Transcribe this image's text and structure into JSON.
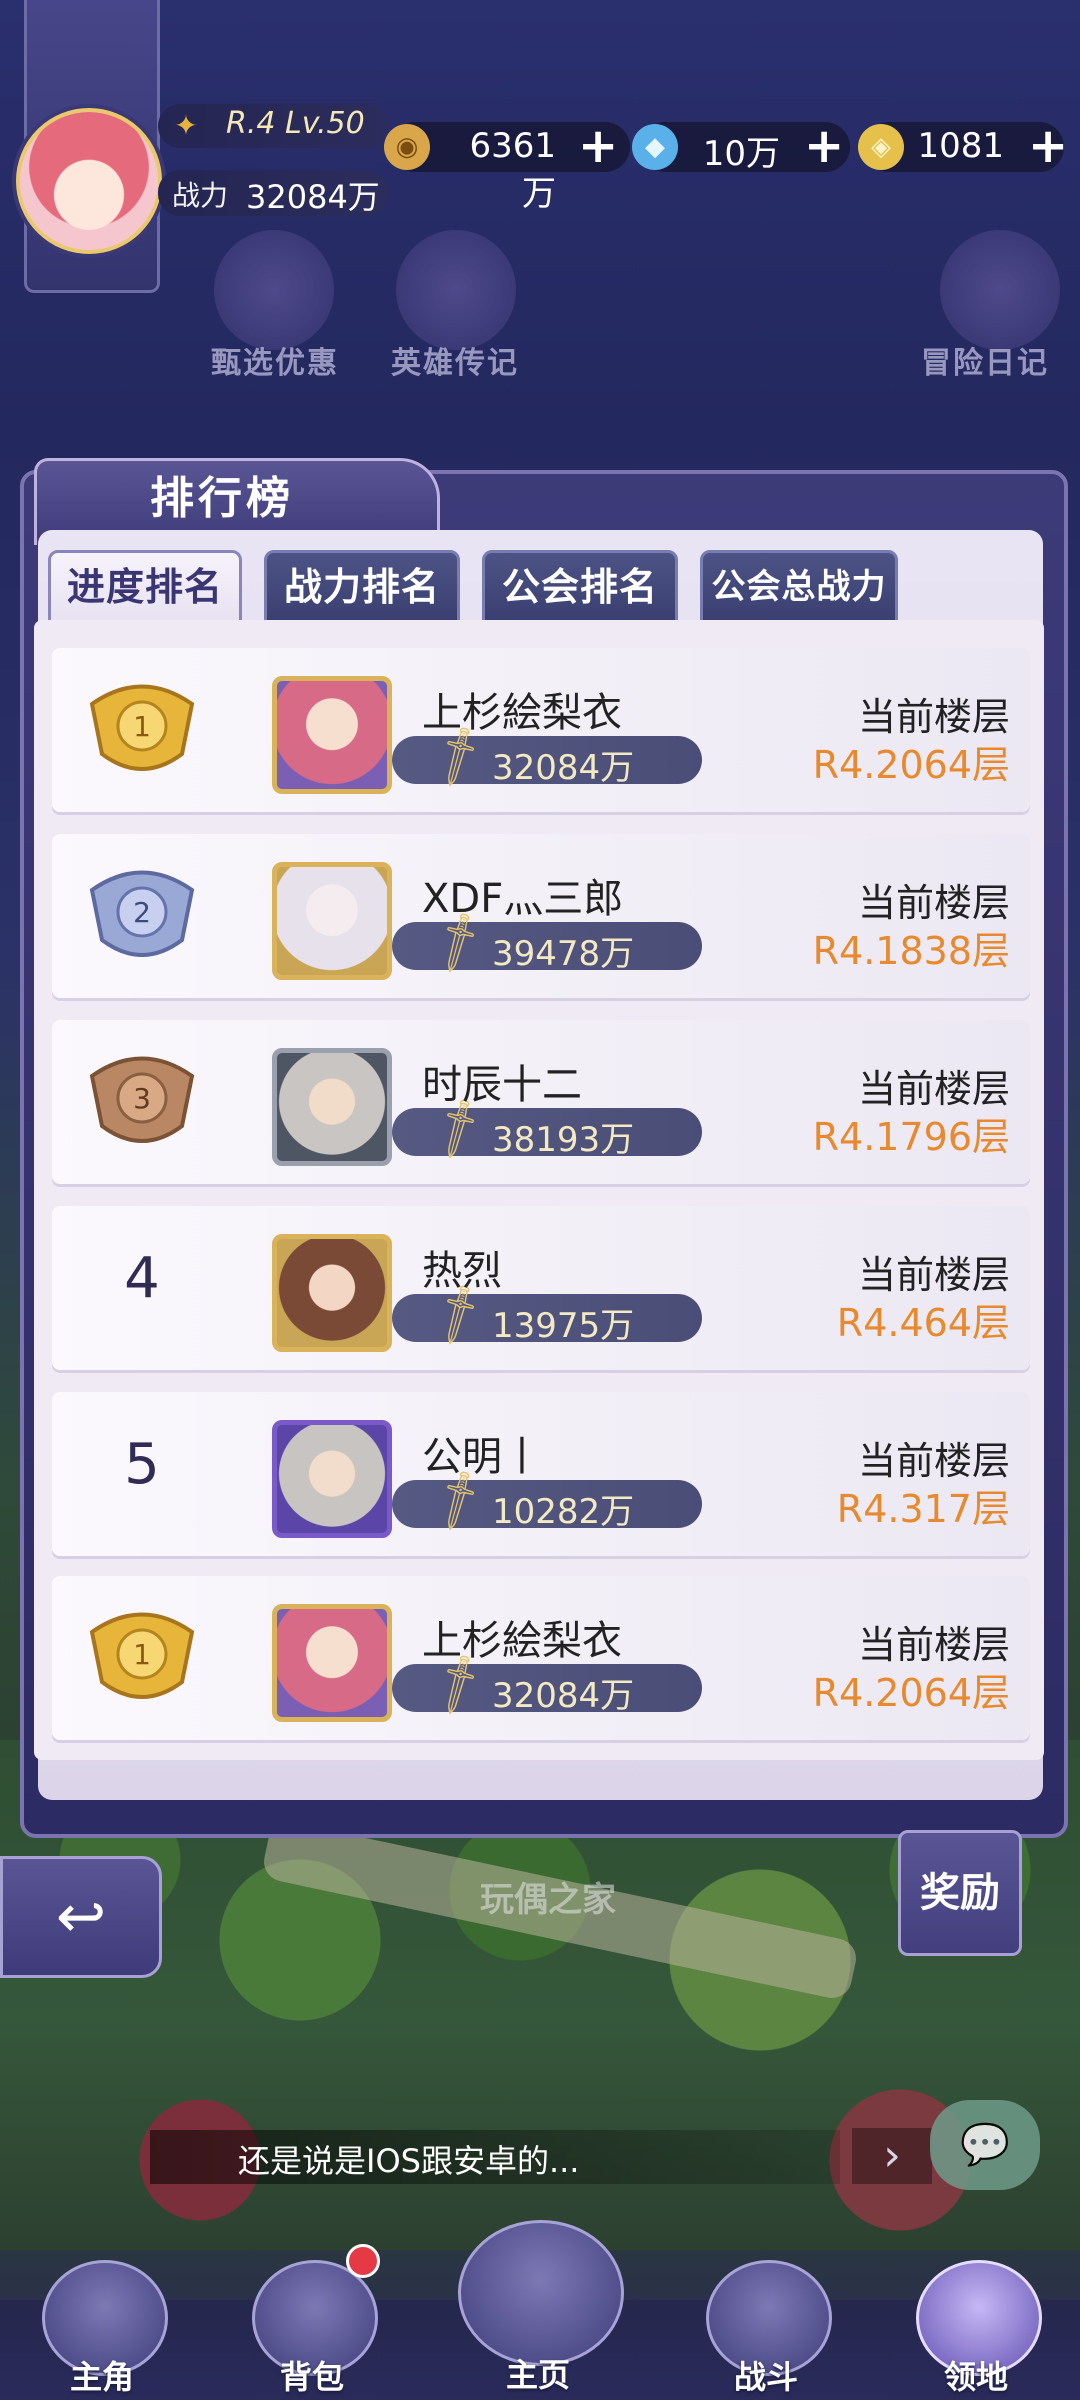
{
  "profile": {
    "level": "R.4 Lv.50",
    "power_label": "战力",
    "power_value": "32084万"
  },
  "resources": [
    {
      "icon": "gold-coin-icon",
      "value": "6361万"
    },
    {
      "icon": "diamond-icon",
      "value": "10万"
    },
    {
      "icon": "gem-icon",
      "value": "1081"
    }
  ],
  "shortcuts": [
    "甄选优惠",
    "英雄传记",
    "冒险日记"
  ],
  "panel": {
    "title": "排行榜",
    "tabs": [
      "进度排名",
      "战力排名",
      "公会排名",
      "公会总战力"
    ],
    "active_tab_index": 0
  },
  "rankings": [
    {
      "rank": "1",
      "name": "上杉絵梨衣",
      "power": "32084万",
      "floor_label": "当前楼层",
      "floor": "R4.2064层"
    },
    {
      "rank": "2",
      "name": "XDF灬三郎",
      "power": "39478万",
      "floor_label": "当前楼层",
      "floor": "R4.1838层"
    },
    {
      "rank": "3",
      "name": "时辰十二",
      "power": "38193万",
      "floor_label": "当前楼层",
      "floor": "R4.1796层"
    },
    {
      "rank": "4",
      "name": "热烈",
      "power": "13975万",
      "floor_label": "当前楼层",
      "floor": "R4.464层"
    },
    {
      "rank": "5",
      "name": "公明丨",
      "power": "10282万",
      "floor_label": "当前楼层",
      "floor": "R4.317层"
    }
  ],
  "my_rank": {
    "rank": "1",
    "name": "上杉絵梨衣",
    "power": "32084万",
    "floor_label": "当前楼层",
    "floor": "R4.2064层"
  },
  "reward_button": "奖励",
  "place_label": "玩偶之家",
  "chat": {
    "message": "还是说是IOS跟安卓的..."
  },
  "nav": [
    "主角",
    "背包",
    "主页",
    "战斗",
    "领地"
  ],
  "colors": {
    "accent": "#e8892e",
    "panel": "#3d3a78",
    "badge": "#e53a45"
  }
}
